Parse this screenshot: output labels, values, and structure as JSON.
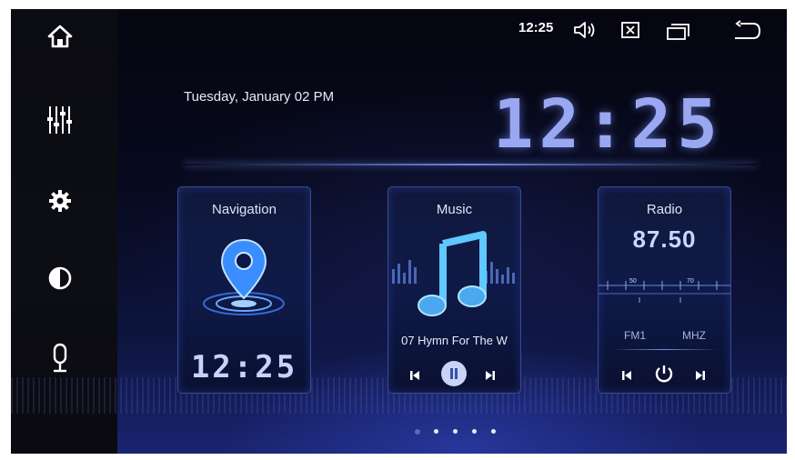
{
  "status_bar": {
    "time": "12:25"
  },
  "clock": {
    "date": "Tuesday, January 02  PM",
    "time": "12:25"
  },
  "cards": {
    "navigation": {
      "title": "Navigation",
      "time": "12:25"
    },
    "music": {
      "title": "Music",
      "track": "07 Hymn For The W"
    },
    "radio": {
      "title": "Radio",
      "frequency": "87.50",
      "band": "FM1",
      "unit": "MHZ",
      "scale": [
        "50",
        "70"
      ]
    }
  },
  "pager": {
    "count": 5,
    "active": 0
  },
  "colors": {
    "accent": "#9aa8f2",
    "card_border": "#3a4a92",
    "background": "#05060d"
  },
  "icons": {
    "home": "home-icon",
    "equalizer": "equalizer-icon",
    "settings": "gear-icon",
    "brightness": "contrast-icon",
    "voice": "microphone-icon",
    "volume": "speaker-icon",
    "close": "close-box-icon",
    "recent": "recent-apps-icon",
    "back": "back-arrow-icon"
  }
}
